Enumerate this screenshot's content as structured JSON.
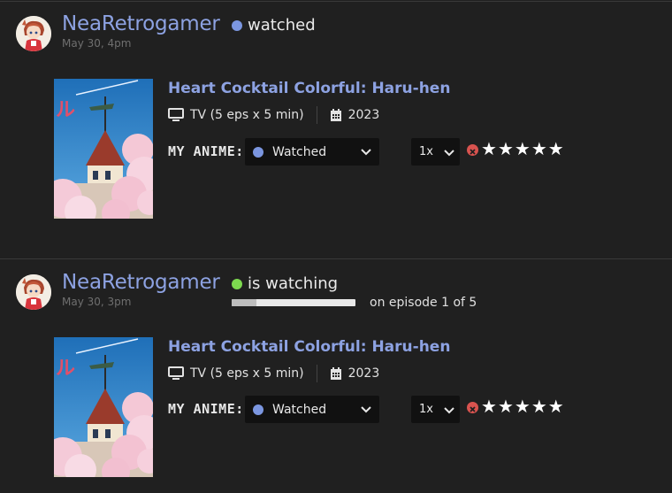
{
  "entries": [
    {
      "username": "NeaRetrogamer",
      "timestamp": "May 30, 4pm",
      "status_text": "watched",
      "status_color": "#7b96e0",
      "progress": null,
      "anime": {
        "title": "Heart Cocktail Colorful: Haru-hen",
        "format": "TV (5 eps x 5 min)",
        "year": "2023"
      },
      "my_anime_label": "MY ANIME:",
      "list_status": "Watched",
      "rewatch": "1x",
      "stars": [
        "★",
        "★",
        "★",
        "★",
        "★"
      ]
    },
    {
      "username": "NeaRetrogamer",
      "timestamp": "May 30, 3pm",
      "status_text": "is watching",
      "status_color": "#7dd94f",
      "progress": {
        "episode": 1,
        "total": 5,
        "text": "on episode 1 of 5"
      },
      "anime": {
        "title": "Heart Cocktail Colorful: Haru-hen",
        "format": "TV (5 eps x 5 min)",
        "year": "2023"
      },
      "my_anime_label": "MY ANIME:",
      "list_status": "Watched",
      "rewatch": "1x",
      "stars": [
        "★",
        "★",
        "★",
        "★",
        "★"
      ]
    }
  ],
  "icons": {
    "tv": "tv-icon",
    "calendar": "calendar-icon",
    "clear": "clear-rating-icon",
    "star": "star-icon",
    "chevron": "chevron-down-icon"
  },
  "colors": {
    "link": "#8da2e2",
    "background": "#202020",
    "watched_dot": "#7b96e0",
    "watching_dot": "#7dd94f"
  }
}
